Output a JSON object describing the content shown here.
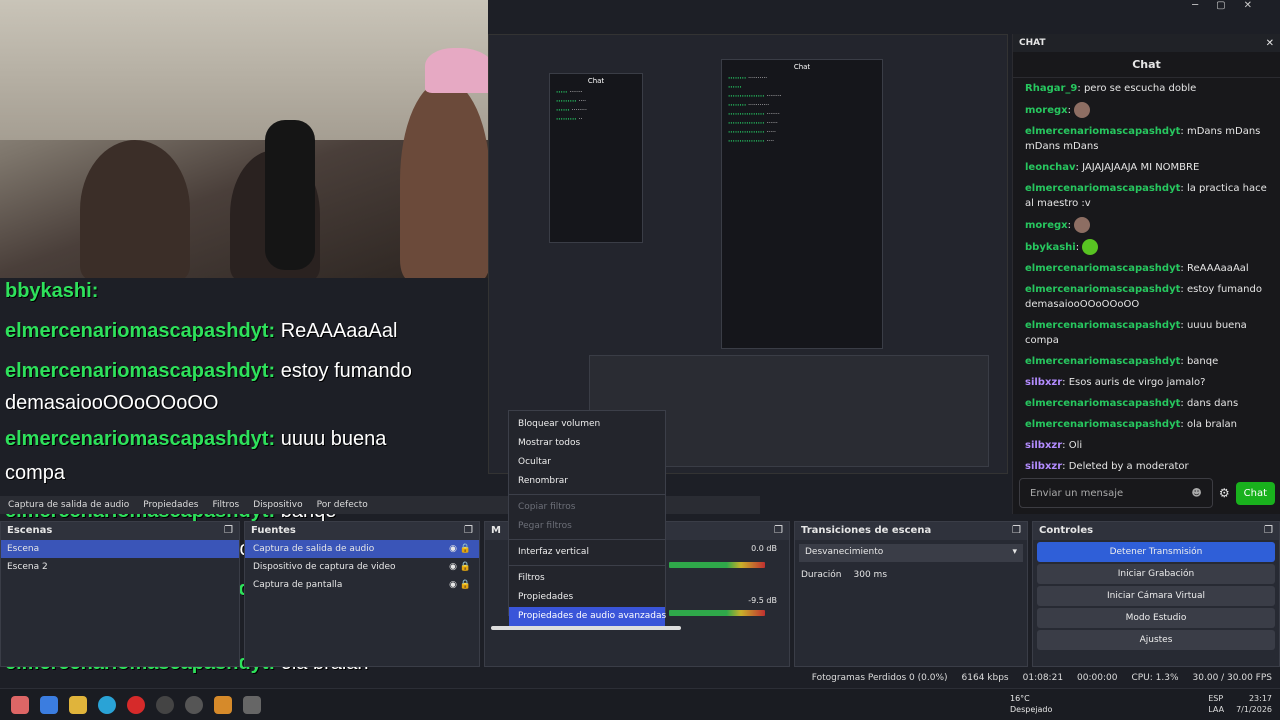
{
  "window": {
    "minimize": "─",
    "maximize": "▢",
    "close": "✕"
  },
  "chat": {
    "dock_title": "CHAT",
    "title": "Chat",
    "messages": [
      {
        "user": "Rhagar_9",
        "text": "pero se escucha doble",
        "color": "#27c75f"
      },
      {
        "user": "moregx",
        "text": "",
        "emote": "brown",
        "color": "#27c75f"
      },
      {
        "user": "elmercenariomascapashdyt",
        "text": "mDans mDans mDans mDans",
        "color": "#27c75f"
      },
      {
        "user": "leonchav",
        "text": "JAJAJAJAAJA MI NOMBRE",
        "color": "#27c75f"
      },
      {
        "user": "elmercenariomascapashdyt",
        "text": "la practica hace al maestro :v",
        "color": "#27c75f"
      },
      {
        "user": "moregx",
        "text": "",
        "emote": "brown",
        "color": "#27c75f"
      },
      {
        "user": "bbykashi",
        "text": "",
        "emote": "green",
        "color": "#27c75f"
      },
      {
        "user": "elmercenariomascapashdyt",
        "text": "ReAAAaaAal",
        "color": "#27c75f"
      },
      {
        "user": "elmercenariomascapashdyt",
        "text": "estoy fumando demasaiooOOoOOoOO",
        "color": "#27c75f"
      },
      {
        "user": "elmercenariomascapashdyt",
        "text": "uuuu buena compa",
        "color": "#27c75f"
      },
      {
        "user": "elmercenariomascapashdyt",
        "text": "banqe",
        "color": "#27c75f"
      },
      {
        "user": "silbxzr",
        "text": "Esos auris de virgo jamalo?",
        "color": "#b38cff"
      },
      {
        "user": "elmercenariomascapashdyt",
        "text": "dans dans",
        "color": "#27c75f"
      },
      {
        "user": "elmercenariomascapashdyt",
        "text": "ola bralan",
        "color": "#27c75f"
      },
      {
        "user": "silbxzr",
        "text": "Oli",
        "color": "#b38cff"
      },
      {
        "user": "silbxzr",
        "text": "Deleted by a moderator",
        "color": "#b38cff"
      }
    ],
    "input_placeholder": "Enviar un mensaje",
    "send": "Chat"
  },
  "overlay": {
    "lines": [
      {
        "user": "bbykashi:",
        "text": "",
        "user_color": "green"
      },
      {
        "user": "elmercenariomascapashdyt:",
        "text": "ReAAAaaAal",
        "user_color": "green"
      },
      {
        "user": "elmercenariomascapashdyt:",
        "text": "estoy fumando",
        "user_color": "green"
      },
      {
        "user": "",
        "text": "demasaiooOOoOOoOO",
        "user_color": "green"
      },
      {
        "user": "elmercenariomascapashdyt:",
        "text": "uuuu buena",
        "user_color": "green"
      },
      {
        "user": "",
        "text": "compa",
        "user_color": "green"
      },
      {
        "user": "elmercenariomascapashdyt:",
        "text": "banqe",
        "user_color": "green"
      },
      {
        "user": "silbxzr:",
        "text": "Esos auris de virgo jamalo?",
        "user_color": "purple"
      },
      {
        "user": "elmercenariomascapashdyt:",
        "text": "",
        "user_color": "green"
      },
      {
        "user": "elmercenariomascapashdyt:",
        "text": "ola braian",
        "user_color": "green"
      },
      {
        "user": "silbxzr:",
        "text": "Oli",
        "user_color": "purple"
      }
    ]
  },
  "toolbar": {
    "audio_capture": "Captura de salida de audio",
    "properties": "Propiedades",
    "filters": "Filtros",
    "device": "Dispositivo",
    "default": "Por defecto"
  },
  "scenes": {
    "title": "Escenas",
    "items": [
      "Escena",
      "Escena 2"
    ]
  },
  "sources": {
    "title": "Fuentes",
    "items": [
      "Captura de salida de audio",
      "Dispositivo de captura de video",
      "Captura de pantalla"
    ]
  },
  "mixer": {
    "title": "M",
    "db1": "0.0 dB",
    "db2": "-9.5 dB"
  },
  "transitions": {
    "title": "Transiciones de escena",
    "type": "Desvanecimiento",
    "duration_label": "Duración",
    "duration": "300 ms"
  },
  "controls": {
    "title": "Controles",
    "buttons": [
      "Detener Transmisión",
      "Iniciar Grabación",
      "Iniciar Cámara Virtual",
      "Modo Estudio",
      "Ajustes"
    ]
  },
  "context_menu": {
    "items": [
      {
        "label": "Bloquear volumen",
        "state": "normal"
      },
      {
        "label": "Mostrar todos",
        "state": "normal"
      },
      {
        "label": "Ocultar",
        "state": "normal"
      },
      {
        "label": "Renombrar",
        "state": "normal"
      },
      {
        "label": "Copiar filtros",
        "state": "disabled"
      },
      {
        "label": "Pegar filtros",
        "state": "disabled"
      },
      {
        "label": "Interfaz vertical",
        "state": "normal"
      },
      {
        "label": "Filtros",
        "state": "normal"
      },
      {
        "label": "Propiedades",
        "state": "normal"
      },
      {
        "label": "Propiedades de audio avanzadas",
        "state": "selected"
      }
    ]
  },
  "status": {
    "dropped": "Fotogramas Perdidos 0 (0.0%)",
    "bitrate": "6164 kbps",
    "live_time": "01:08:21",
    "rec_time": "00:00:00",
    "cpu": "CPU: 1.3%",
    "fps": "30.00 / 30.00 FPS"
  },
  "taskbar": {
    "weather_temp": "16°C",
    "weather_desc": "Despejado",
    "lang1": "ESP",
    "lang2": "LAA",
    "time": "23:17",
    "date": "7/1/2026"
  }
}
